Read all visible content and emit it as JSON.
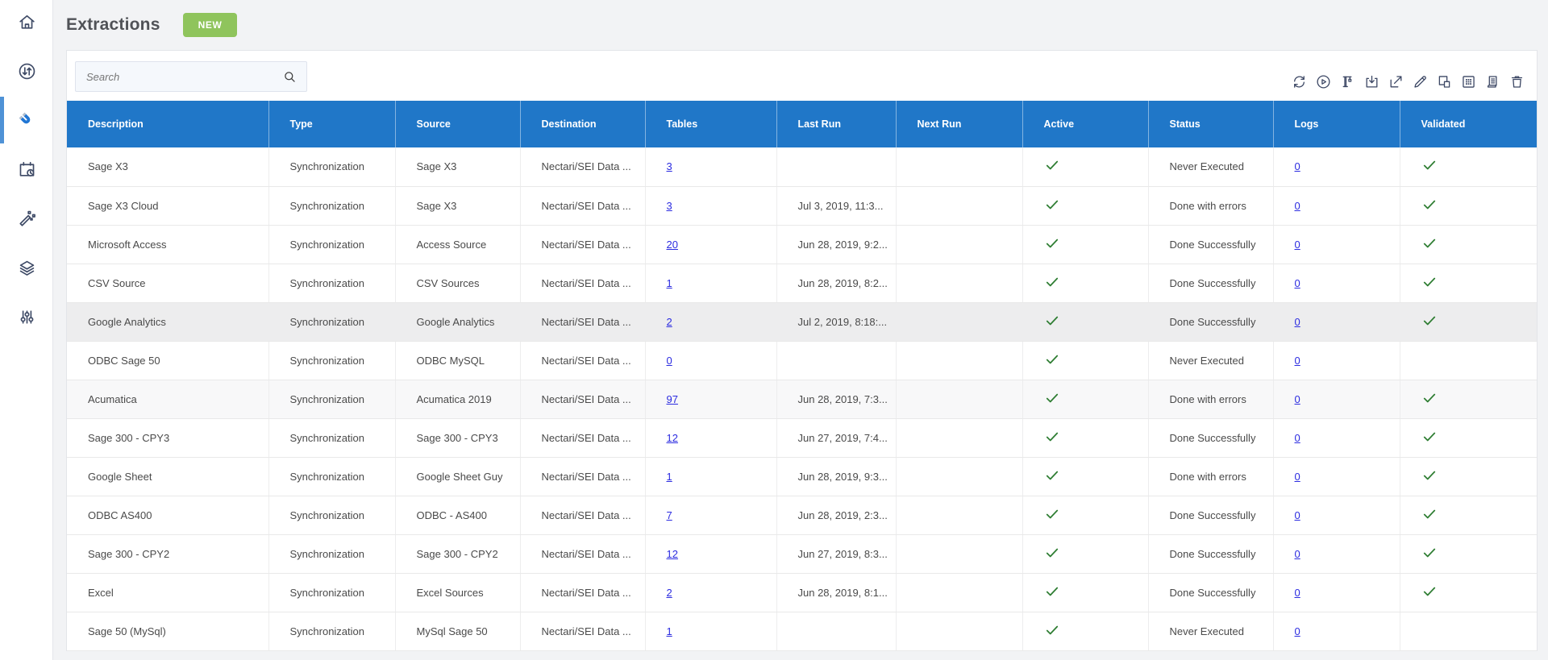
{
  "page": {
    "title": "Extractions",
    "new_badge_label": "NEW"
  },
  "search": {
    "placeholder": "Search",
    "value": ""
  },
  "sidebar": {
    "active_item": "extractions",
    "items": [
      "home",
      "data-transfer",
      "extractions",
      "schedule",
      "design-tools",
      "layers",
      "settings"
    ]
  },
  "toolbar_icons": [
    "refresh",
    "run",
    "builder",
    "import",
    "export",
    "edit",
    "duplicate",
    "grid",
    "logs",
    "delete"
  ],
  "colors": {
    "header_blue": "#2077c8",
    "badge_green": "#8fc45c",
    "check_green": "#2e7d32",
    "link_blue": "#2b2be0",
    "active_indicator_blue": "#4f92d6"
  },
  "table": {
    "columns": [
      "Description",
      "Type",
      "Source",
      "Destination",
      "Tables",
      "Last Run",
      "Next Run",
      "Active",
      "Status",
      "Logs",
      "Validated"
    ],
    "rows": [
      {
        "description": "Sage X3",
        "type": "Synchronization",
        "source": "Sage X3",
        "destination": "Nectari/SEI Data ...",
        "tables": "3",
        "last_run": "",
        "next_run": "",
        "active": true,
        "status": "Never Executed",
        "logs": "0",
        "validated": true,
        "row_state": ""
      },
      {
        "description": "Sage X3 Cloud",
        "type": "Synchronization",
        "source": "Sage X3",
        "destination": "Nectari/SEI Data ...",
        "tables": "3",
        "last_run": "Jul 3, 2019, 11:3...",
        "next_run": "",
        "active": true,
        "status": "Done with errors",
        "logs": "0",
        "validated": true,
        "row_state": ""
      },
      {
        "description": "Microsoft Access",
        "type": "Synchronization",
        "source": "Access Source",
        "destination": "Nectari/SEI Data ...",
        "tables": "20",
        "last_run": "Jun 28, 2019, 9:2...",
        "next_run": "",
        "active": true,
        "status": "Done Successfully",
        "logs": "0",
        "validated": true,
        "row_state": ""
      },
      {
        "description": "CSV Source",
        "type": "Synchronization",
        "source": "CSV Sources",
        "destination": "Nectari/SEI Data ...",
        "tables": "1",
        "last_run": "Jun 28, 2019, 8:2...",
        "next_run": "",
        "active": true,
        "status": "Done Successfully",
        "logs": "0",
        "validated": true,
        "row_state": ""
      },
      {
        "description": "Google Analytics",
        "type": "Synchronization",
        "source": "Google Analytics",
        "destination": "Nectari/SEI Data ...",
        "tables": "2",
        "last_run": "Jul 2, 2019, 8:18:...",
        "next_run": "",
        "active": true,
        "status": "Done Successfully",
        "logs": "0",
        "validated": true,
        "row_state": "selected"
      },
      {
        "description": "ODBC Sage 50",
        "type": "Synchronization",
        "source": "ODBC MySQL",
        "destination": "Nectari/SEI Data ...",
        "tables": "0",
        "last_run": "",
        "next_run": "",
        "active": true,
        "status": "Never Executed",
        "logs": "0",
        "validated": false,
        "row_state": ""
      },
      {
        "description": "Acumatica",
        "type": "Synchronization",
        "source": "Acumatica 2019",
        "destination": "Nectari/SEI Data ...",
        "tables": "97",
        "last_run": "Jun 28, 2019, 7:3...",
        "next_run": "",
        "active": true,
        "status": "Done with errors",
        "logs": "0",
        "validated": true,
        "row_state": "subtle"
      },
      {
        "description": "Sage 300 - CPY3",
        "type": "Synchronization",
        "source": "Sage 300 - CPY3",
        "destination": "Nectari/SEI Data ...",
        "tables": "12",
        "last_run": "Jun 27, 2019, 7:4...",
        "next_run": "",
        "active": true,
        "status": "Done Successfully",
        "logs": "0",
        "validated": true,
        "row_state": ""
      },
      {
        "description": "Google Sheet",
        "type": "Synchronization",
        "source": "Google Sheet Guy",
        "destination": "Nectari/SEI Data ...",
        "tables": "1",
        "last_run": "Jun 28, 2019, 9:3...",
        "next_run": "",
        "active": true,
        "status": "Done with errors",
        "logs": "0",
        "validated": true,
        "row_state": ""
      },
      {
        "description": "ODBC AS400",
        "type": "Synchronization",
        "source": "ODBC - AS400",
        "destination": "Nectari/SEI Data ...",
        "tables": "7",
        "last_run": "Jun 28, 2019, 2:3...",
        "next_run": "",
        "active": true,
        "status": "Done Successfully",
        "logs": "0",
        "validated": true,
        "row_state": ""
      },
      {
        "description": "Sage 300 - CPY2",
        "type": "Synchronization",
        "source": "Sage 300 - CPY2",
        "destination": "Nectari/SEI Data ...",
        "tables": "12",
        "last_run": "Jun 27, 2019, 8:3...",
        "next_run": "",
        "active": true,
        "status": "Done Successfully",
        "logs": "0",
        "validated": true,
        "row_state": ""
      },
      {
        "description": "Excel",
        "type": "Synchronization",
        "source": "Excel Sources",
        "destination": "Nectari/SEI Data ...",
        "tables": "2",
        "last_run": "Jun 28, 2019, 8:1...",
        "next_run": "",
        "active": true,
        "status": "Done Successfully",
        "logs": "0",
        "validated": true,
        "row_state": ""
      },
      {
        "description": "Sage 50 (MySql)",
        "type": "Synchronization",
        "source": "MySql Sage 50",
        "destination": "Nectari/SEI Data ...",
        "tables": "1",
        "last_run": "",
        "next_run": "",
        "active": true,
        "status": "Never Executed",
        "logs": "0",
        "validated": false,
        "row_state": ""
      }
    ]
  }
}
